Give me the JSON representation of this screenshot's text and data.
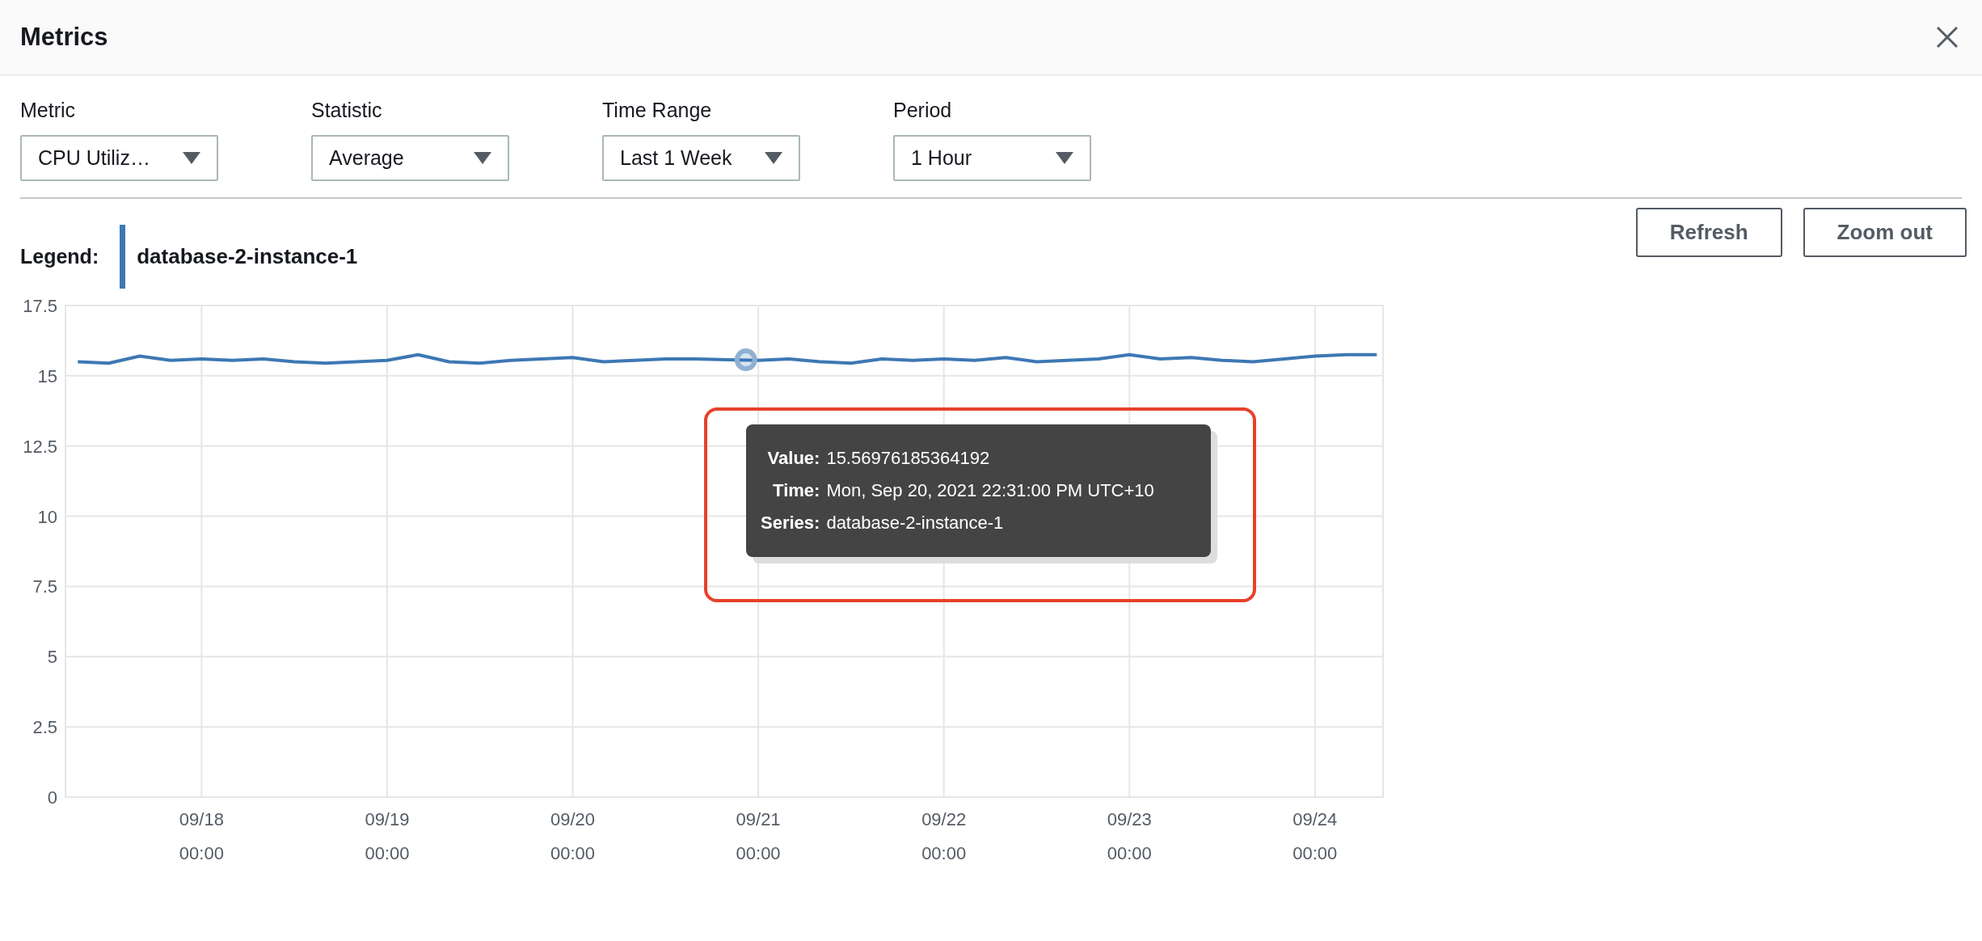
{
  "header": {
    "title": "Metrics"
  },
  "filters": [
    {
      "label": "Metric",
      "value": "CPU Utiliz…"
    },
    {
      "label": "Statistic",
      "value": "Average"
    },
    {
      "label": "Time Range",
      "value": "Last 1 Week"
    },
    {
      "label": "Period",
      "value": "1 Hour"
    }
  ],
  "actions": [
    "Refresh",
    "Zoom out"
  ],
  "legend": {
    "label": "Legend:"
  },
  "chart_data": {
    "type": "line",
    "grid": true,
    "ylim": [
      0,
      17.5
    ],
    "yticks": [
      0,
      2.5,
      5,
      7.5,
      10,
      12.5,
      15,
      17.5
    ],
    "categories": [
      null,
      null,
      null,
      null,
      "09/18 00:00",
      null,
      null,
      null,
      null,
      null,
      "09/19 00:00",
      null,
      null,
      null,
      null,
      null,
      "09/20 00:00",
      null,
      null,
      null,
      null,
      null,
      "09/21 00:00",
      null,
      null,
      null,
      null,
      null,
      "09/22 00:00",
      null,
      null,
      null,
      null,
      null,
      "09/23 00:00",
      null,
      null,
      null,
      null,
      null,
      "09/24 00:00",
      null,
      null
    ],
    "series": [
      {
        "name": "database-2-instance-1",
        "color": "#3d78b4",
        "values": [
          15.5,
          15.45,
          15.7,
          15.55,
          15.6,
          15.55,
          15.6,
          15.5,
          15.45,
          15.5,
          15.55,
          15.75,
          15.5,
          15.45,
          15.55,
          15.6,
          15.65,
          15.5,
          15.55,
          15.6,
          15.6,
          15.57,
          15.55,
          15.6,
          15.5,
          15.45,
          15.6,
          15.55,
          15.6,
          15.55,
          15.65,
          15.5,
          15.55,
          15.6,
          15.75,
          15.6,
          15.65,
          15.55,
          15.5,
          15.6,
          15.7,
          15.75,
          15.75
        ]
      }
    ]
  },
  "tooltip": {
    "rows": [
      {
        "label": "Value:",
        "value": "15.56976185364192"
      },
      {
        "label": "Time:",
        "value": "Mon, Sep 20, 2021 22:31:00 PM UTC+10"
      },
      {
        "label": "Series:",
        "value": "database-2-instance-1"
      }
    ]
  }
}
